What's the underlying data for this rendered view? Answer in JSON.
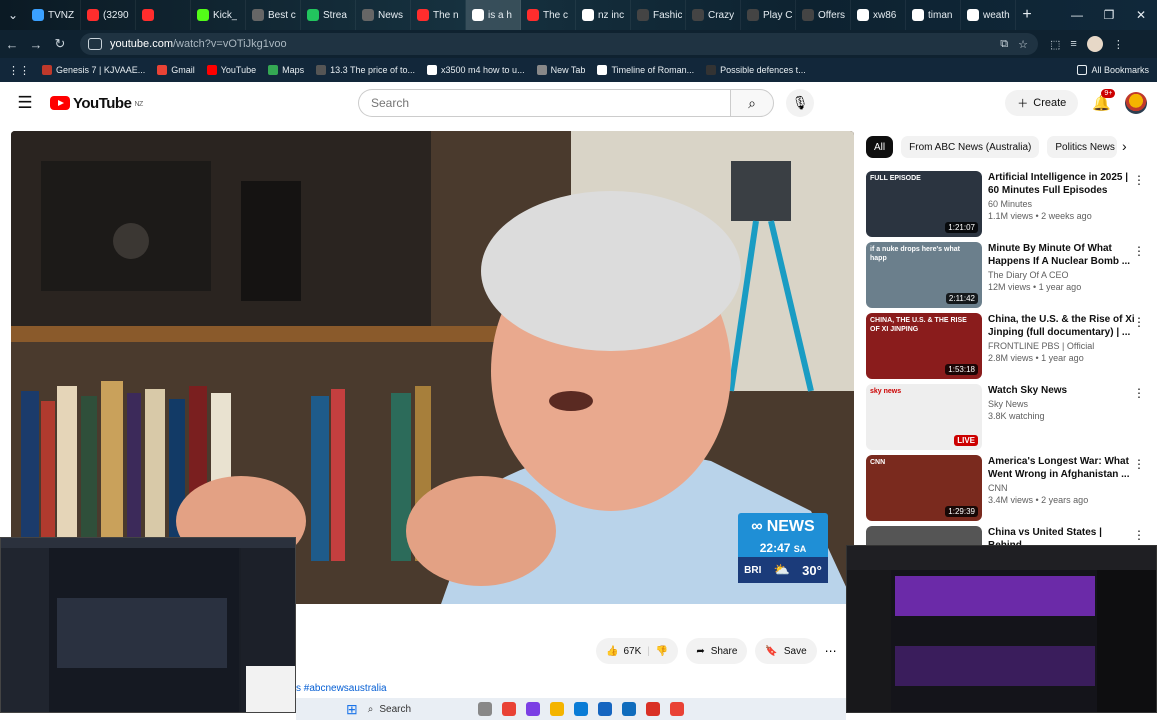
{
  "browser": {
    "tabs": [
      {
        "label": "TVNZ",
        "color": "#3aa0ff"
      },
      {
        "label": "(3290",
        "color": "#ff2d2d"
      },
      {
        "label": "",
        "color": "#ff2d2d"
      },
      {
        "label": "Kick_",
        "color": "#53fc18"
      },
      {
        "label": "Best c",
        "color": "#666666"
      },
      {
        "label": "Strea",
        "color": "#22c55e"
      },
      {
        "label": "News",
        "color": "#666666"
      },
      {
        "label": "The n",
        "color": "#ff2d2d"
      },
      {
        "label": "is a h",
        "color": "#ffffff"
      },
      {
        "label": "The c",
        "color": "#ff2d2d"
      },
      {
        "label": "nz inc",
        "color": "#ffffff"
      },
      {
        "label": "Fashic",
        "color": "#444444"
      },
      {
        "label": "Crazy",
        "color": "#444444"
      },
      {
        "label": "Play C",
        "color": "#444444"
      },
      {
        "label": "Offers",
        "color": "#444444"
      },
      {
        "label": "xw86",
        "color": "#ffffff"
      },
      {
        "label": "timan",
        "color": "#ffffff"
      },
      {
        "label": "weath",
        "color": "#ffffff"
      }
    ],
    "new_tab_label": "+",
    "url_host": "youtube.com",
    "url_rest": "/watch?v=vOTiJkg1voo",
    "bookmarks": [
      {
        "label": "Genesis 7 | KJVAAE...",
        "color": "#c0392b"
      },
      {
        "label": "Gmail",
        "color": "#ea4335"
      },
      {
        "label": "YouTube",
        "color": "#ff0000"
      },
      {
        "label": "Maps",
        "color": "#34a853"
      },
      {
        "label": "13.3 The price of to...",
        "color": "#555555"
      },
      {
        "label": "x3500 m4 how to u...",
        "color": "#ffffff"
      },
      {
        "label": "New Tab",
        "color": "#888888"
      },
      {
        "label": "Timeline of Roman...",
        "color": "#ffffff"
      },
      {
        "label": "Possible defences t...",
        "color": "#333333"
      }
    ],
    "all_bookmarks_label": "All Bookmarks"
  },
  "youtube": {
    "logo_text": "YouTube",
    "region": "NZ",
    "search_placeholder": "Search",
    "create_label": "Create",
    "notif_count": "9+",
    "video": {
      "abc_brand": "NEWS",
      "abc_time": "22:47",
      "abc_tz": "SA",
      "abc_city": "BRI",
      "abc_temp": "30°"
    },
    "actions": {
      "like_count": "67K",
      "share_label": "Share",
      "save_label": "Save"
    },
    "hashtags": "s #abcnewsaustralia",
    "chips": [
      "All",
      "From ABC News (Australia)",
      "Politics News"
    ],
    "recommended": [
      {
        "title": "Artificial Intelligence in 2025 | 60 Minutes Full Episodes",
        "channel": "60 Minutes",
        "stats": "1.1M views • 2 weeks ago",
        "duration": "1:21:07",
        "tag": "FULL EPISODE",
        "thumb": "#2b3440"
      },
      {
        "title": "Minute By Minute Of What Happens If A Nuclear Bomb ...",
        "channel": "The Diary Of A CEO",
        "stats": "12M views • 1 year ago",
        "duration": "2:11:42",
        "tag": "if a nuke drops here's what happ",
        "thumb": "#6b7f8c"
      },
      {
        "title": "China, the U.S. & the Rise of Xi Jinping (full documentary) | ...",
        "channel": "FRONTLINE PBS | Official",
        "stats": "2.8M views • 1 year ago",
        "duration": "1:53:18",
        "tag": "CHINA, THE U.S. & THE RISE OF XI JINPING",
        "thumb": "#8a1c1c"
      },
      {
        "title": "Watch Sky News",
        "channel": "Sky News",
        "stats": "3.8K watching",
        "duration": "LIVE",
        "tag": "sky news",
        "thumb": "#eeeeee"
      },
      {
        "title": "America's Longest War: What Went Wrong in Afghanistan ...",
        "channel": "CNN",
        "stats": "3.4M views • 2 years ago",
        "duration": "1:29:39",
        "tag": "CNN",
        "thumb": "#7a2a1e"
      },
      {
        "title": "China vs United States | Behind",
        "channel": "",
        "stats": "",
        "duration": "",
        "tag": "",
        "thumb": "#555555"
      }
    ]
  },
  "taskbar": {
    "search_label": "Search"
  }
}
